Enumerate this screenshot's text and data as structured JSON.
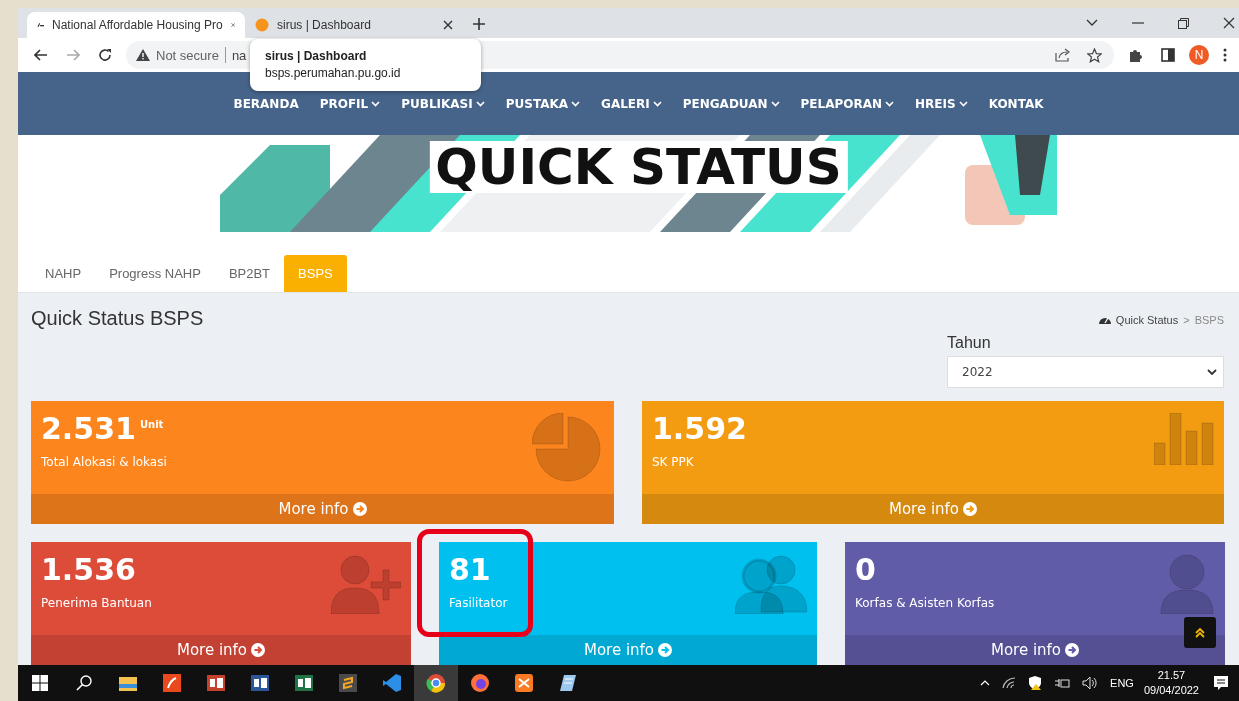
{
  "browser": {
    "tabs": [
      {
        "title": "National Affordable Housing Pro",
        "selected": true
      },
      {
        "title": "sirus | Dashboard",
        "selected": false
      }
    ],
    "address": {
      "security": "Not secure",
      "url": "na"
    },
    "tooltip": {
      "title": "sirus | Dashboard",
      "url": "bsps.perumahan.pu.go.id"
    },
    "profile_initial": "N"
  },
  "nav": [
    {
      "label": "BERANDA",
      "dropdown": false
    },
    {
      "label": "PROFIL",
      "dropdown": true
    },
    {
      "label": "PUBLIKASI",
      "dropdown": true
    },
    {
      "label": "PUSTAKA",
      "dropdown": true
    },
    {
      "label": "GALERI",
      "dropdown": true
    },
    {
      "label": "PENGADUAN",
      "dropdown": true
    },
    {
      "label": "PELAPORAN",
      "dropdown": true
    },
    {
      "label": "HREIS",
      "dropdown": true
    },
    {
      "label": "KONTAK",
      "dropdown": false
    }
  ],
  "banner": {
    "title": "QUICK STATUS"
  },
  "page_tabs": [
    {
      "label": "NAHP",
      "selected": false
    },
    {
      "label": "Progress NAHP",
      "selected": false
    },
    {
      "label": "BP2BT",
      "selected": false
    },
    {
      "label": "BSPS",
      "selected": true
    }
  ],
  "heading": "Quick Status BSPS",
  "breadcrumb": {
    "items": [
      "Quick Status",
      "BSPS"
    ],
    "separator": ">"
  },
  "year_filter": {
    "label": "Tahun",
    "value": "2022"
  },
  "stat_boxes": [
    {
      "value": "2.531",
      "unit": "Unit",
      "label": "Total Alokasi & lokasi",
      "link": "More info",
      "color": "#fd851d",
      "highlighted": false
    },
    {
      "value": "1.592",
      "label": "SK PPK",
      "link": "More info",
      "color": "#f39c12",
      "highlighted": false
    },
    {
      "value": "1.536",
      "label": "Penerima Bantuan",
      "link": "More info",
      "color": "#dd4b39",
      "highlighted": false
    },
    {
      "value": "81",
      "label": "Fasilitator",
      "link": "More info",
      "color": "#00c0ef",
      "highlighted": true
    },
    {
      "value": "0",
      "label": "Korfas & Asisten Korfas",
      "link": "More info",
      "color": "#605ca8",
      "highlighted": false
    }
  ],
  "taskbar": {
    "language": "ENG",
    "time": "21.57",
    "date": "09/04/2022"
  }
}
